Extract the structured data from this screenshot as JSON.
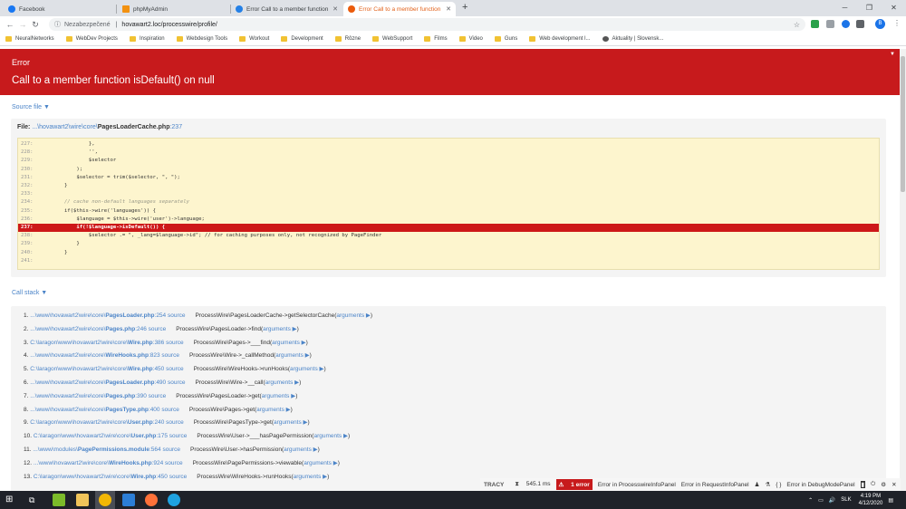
{
  "browser": {
    "tabs": [
      {
        "label": "Facebook",
        "icon": "facebook-icon",
        "color": "#1877f2"
      },
      {
        "label": "phpMyAdmin",
        "icon": "phpmyadmin-icon",
        "color": "#f29111"
      },
      {
        "label": "Error Call to a member function",
        "icon": "processwire-icon",
        "color": "#2480e6"
      },
      {
        "label": "Error Call to a member function",
        "icon": "processwire-icon",
        "color": "#ea5b0c"
      }
    ],
    "new_tab": "+",
    "window_controls": {
      "minimize": "─",
      "maximize": "❐",
      "close": "✕"
    },
    "address": {
      "security": "Nezabezpečené",
      "url": "hovawart2.loc/processwire/profile/"
    },
    "profile_initial": "B",
    "bookmarks": [
      "NeuralNetworks",
      "WebDev Projects",
      "Inspiration",
      "Webdesign Tools",
      "Workout",
      "Development",
      "Rôzne",
      "WebSupport",
      "Films",
      "Video",
      "Guns",
      "Web development l...",
      "Aktuality | Slovensk..."
    ]
  },
  "error": {
    "label": "Error",
    "message": "Call to a member function isDefault() on null"
  },
  "source": {
    "heading": "Source file",
    "file_label": "File:",
    "file_prefix": "...\\hovawart2\\wire\\core\\",
    "file_name": "PagesLoaderCache.php",
    "file_line": ":237",
    "lines": [
      {
        "n": "227:",
        "code": "                }, "
      },
      {
        "n": "228:",
        "code": "                '', "
      },
      {
        "n": "229:",
        "code": "                $selector"
      },
      {
        "n": "230:",
        "code": "            );"
      },
      {
        "n": "231:",
        "code": "            $selector = trim($selector, \", \");"
      },
      {
        "n": "232:",
        "code": "        }"
      },
      {
        "n": "233:",
        "code": ""
      },
      {
        "n": "234:",
        "code": "        // cache non-default languages separately"
      },
      {
        "n": "235:",
        "code": "        if($this->wire('languages')) {"
      },
      {
        "n": "236:",
        "code": "            $language = $this->wire('user')->language;"
      },
      {
        "n": "237:",
        "code": "            if(!$language->isDefault()) {"
      },
      {
        "n": "238:",
        "code": "                $selector .= \", _lang=$language->id\"; // for caching purposes only, not recognized by PageFinder"
      },
      {
        "n": "239:",
        "code": "            }"
      },
      {
        "n": "240:",
        "code": "        }"
      },
      {
        "n": "241:",
        "code": ""
      }
    ]
  },
  "callstack": {
    "heading": "Call stack",
    "rows": [
      {
        "num": "1.",
        "prefix": "...\\www\\hovawart2\\wire\\core\\",
        "file": "PagesLoader.php",
        "line": ":254",
        "src": "source",
        "call": "ProcessWire\\PagesLoaderCache->getSelectorCache(",
        "args": "arguments ▶",
        "end": ")"
      },
      {
        "num": "2.",
        "prefix": "...\\www\\hovawart2\\wire\\core\\",
        "file": "Pages.php",
        "line": ":246",
        "src": "source",
        "call": "ProcessWire\\PagesLoader->find(",
        "args": "arguments ▶",
        "end": ")"
      },
      {
        "num": "3.",
        "prefix": "C:\\laragon\\www\\hovawart2\\wire\\core\\",
        "file": "Wire.php",
        "line": ":386",
        "src": "source",
        "call": "ProcessWire\\Pages->___find(",
        "args": "arguments ▶",
        "end": ")"
      },
      {
        "num": "4.",
        "prefix": "...\\www\\hovawart2\\wire\\core\\",
        "file": "WireHooks.php",
        "line": ":823",
        "src": "source",
        "call": "ProcessWire\\Wire->_callMethod(",
        "args": "arguments ▶",
        "end": ")"
      },
      {
        "num": "5.",
        "prefix": "C:\\laragon\\www\\hovawart2\\wire\\core\\",
        "file": "Wire.php",
        "line": ":450",
        "src": "source",
        "call": "ProcessWire\\WireHooks->runHooks(",
        "args": "arguments ▶",
        "end": ")"
      },
      {
        "num": "6.",
        "prefix": "...\\www\\hovawart2\\wire\\core\\",
        "file": "PagesLoader.php",
        "line": ":490",
        "src": "source",
        "call": "ProcessWire\\Wire->__call(",
        "args": "arguments ▶",
        "end": ")"
      },
      {
        "num": "7.",
        "prefix": "...\\www\\hovawart2\\wire\\core\\",
        "file": "Pages.php",
        "line": ":390",
        "src": "source",
        "call": "ProcessWire\\PagesLoader->get(",
        "args": "arguments ▶",
        "end": ")"
      },
      {
        "num": "8.",
        "prefix": "...\\www\\hovawart2\\wire\\core\\",
        "file": "PagesType.php",
        "line": ":400",
        "src": "source",
        "call": "ProcessWire\\Pages->get(",
        "args": "arguments ▶",
        "end": ")"
      },
      {
        "num": "9.",
        "prefix": "C:\\laragon\\www\\hovawart2\\wire\\core\\",
        "file": "User.php",
        "line": ":240",
        "src": "source",
        "call": "ProcessWire\\PagesType->get(",
        "args": "arguments ▶",
        "end": ")"
      },
      {
        "num": "10.",
        "prefix": "C:\\laragon\\www\\hovawart2\\wire\\core\\",
        "file": "User.php",
        "line": ":175",
        "src": "source",
        "call": "ProcessWire\\User->___hasPagePermission(",
        "args": "arguments ▶",
        "end": ")"
      },
      {
        "num": "11.",
        "prefix": "...\\www\\modules\\",
        "file": "PagePermissions.module",
        "line": ":564",
        "src": "source",
        "call": "ProcessWire\\User->hasPermission(",
        "args": "arguments ▶",
        "end": ")"
      },
      {
        "num": "12.",
        "prefix": "...\\www\\hovawart2\\wire\\core\\",
        "file": "WireHooks.php",
        "line": ":924",
        "src": "source",
        "call": "ProcessWire\\PagePermissions->viewable(",
        "args": "arguments ▶",
        "end": ")"
      },
      {
        "num": "13.",
        "prefix": "C:\\laragon\\www\\hovawart2\\wire\\core\\",
        "file": "Wire.php",
        "line": ":450",
        "src": "source",
        "call": "ProcessWire\\WireHooks->runHooks(",
        "args": "arguments ▶",
        "end": ")"
      }
    ]
  },
  "tracy": {
    "logo": "TRACY",
    "time": "545.1 ms",
    "errors": "1 error",
    "panel1": "Error in ProcesswireInfoPanel",
    "panel2": "Error in RequestInfoPanel",
    "braces": "{ }",
    "panel3": "Error in DebugModePanel"
  },
  "taskbar": {
    "language": "SLK",
    "time": "4:19 PM",
    "date": "4/12/2020",
    "colors": {
      "chrome": "#f2b705",
      "vscode": "#2c7ed6",
      "firefox": "#ff7139",
      "edge": "#1fa2e0"
    }
  }
}
